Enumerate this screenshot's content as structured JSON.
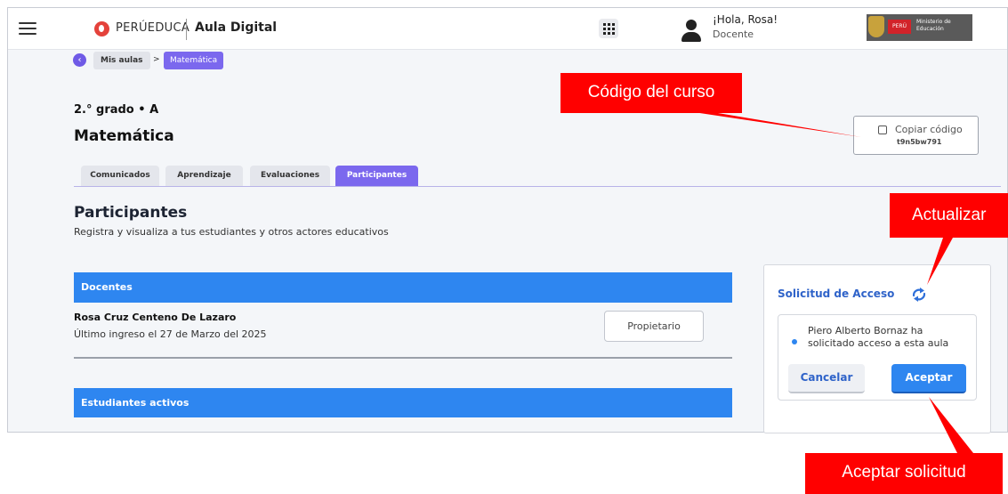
{
  "header": {
    "brand": "PERÚEDUCA",
    "app_name": "Aula Digital",
    "greeting": "¡Hola, Rosa!",
    "role": "Docente",
    "ministry_flag": "PERÚ",
    "ministry_name": "Ministerio de Educación"
  },
  "breadcrumb": {
    "back_icon": "chevron-left-icon",
    "home": "Mis aulas",
    "separator": ">",
    "current": "Matemática"
  },
  "course": {
    "grade": "2.° grado • A",
    "title": "Matemática",
    "copy_label": "Copiar código",
    "code": "t9n5bw791"
  },
  "tabs": [
    {
      "label": "Comunicados",
      "active": false
    },
    {
      "label": "Aprendizaje",
      "active": false
    },
    {
      "label": "Evaluaciones",
      "active": false
    },
    {
      "label": "Participantes",
      "active": true
    }
  ],
  "participants": {
    "title": "Participantes",
    "subtitle": "Registra y visualiza a tus estudiantes y otros actores educativos",
    "teachers_header": "Docentes",
    "teacher_name": "Rosa Cruz Centeno De Lazaro",
    "teacher_last_login": "Último ingreso el 27 de Marzo del 2025",
    "teacher_role": "Propietario",
    "students_header": "Estudiantes activos"
  },
  "access_request": {
    "title": "Solicitud de Acceso",
    "message": "Piero Alberto Bornaz ha solicitado acceso a esta aula",
    "cancel": "Cancelar",
    "accept": "Aceptar"
  },
  "annotations": {
    "course_code": "Código del curso",
    "refresh": "Actualizar",
    "accept_request": "Aceptar solicitud"
  },
  "colors": {
    "accent_purple": "#7b68ee",
    "primary_blue": "#2e86f0",
    "annotation_red": "#ff0000"
  }
}
